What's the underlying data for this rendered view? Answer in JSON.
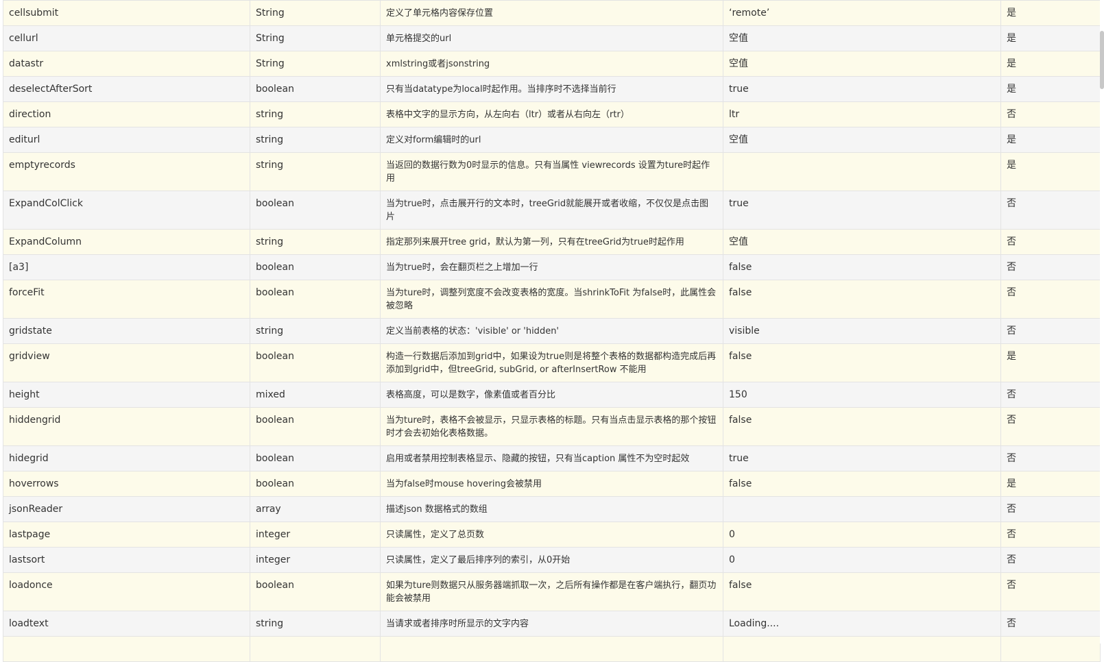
{
  "rows": [
    {
      "name": "cellsubmit",
      "type": "String",
      "desc": "定义了单元格内容保存位置",
      "default": "‘remote’",
      "editable": "是"
    },
    {
      "name": "cellurl",
      "type": "String",
      "desc": "单元格提交的url",
      "default": "空值",
      "editable": "是"
    },
    {
      "name": "datastr",
      "type": "String",
      "desc": "xmlstring或者jsonstring",
      "default": "空值",
      "editable": "是"
    },
    {
      "name": "deselectAfterSort",
      "type": "boolean",
      "desc": "只有当datatype为local时起作用。当排序时不选择当前行",
      "default": "true",
      "editable": "是"
    },
    {
      "name": "direction",
      "type": "string",
      "desc": "表格中文字的显示方向，从左向右（ltr）或者从右向左（rtr）",
      "default": "ltr",
      "editable": "否"
    },
    {
      "name": "editurl",
      "type": "string",
      "desc": "定义对form编辑时的url",
      "default": "空值",
      "editable": "是"
    },
    {
      "name": "emptyrecords",
      "type": "string",
      "desc": "当返回的数据行数为0时显示的信息。只有当属性 viewrecords 设置为ture时起作用",
      "default": "",
      "editable": "是"
    },
    {
      "name": "ExpandColClick",
      "type": "boolean",
      "desc": "当为true时，点击展开行的文本时，treeGrid就能展开或者收缩，不仅仅是点击图片",
      "default": "true",
      "editable": "否"
    },
    {
      "name": "ExpandColumn",
      "type": "string",
      "desc": "指定那列来展开tree grid，默认为第一列，只有在treeGrid为true时起作用",
      "default": "空值",
      "editable": "否"
    },
    {
      "name": "[a3]",
      "type": "boolean",
      "desc": "当为true时，会在翻页栏之上增加一行",
      "default": "false",
      "editable": "否"
    },
    {
      "name": "forceFit",
      "type": "boolean",
      "desc": "当为ture时，调整列宽度不会改变表格的宽度。当shrinkToFit 为false时，此属性会被忽略",
      "default": "false",
      "editable": "否"
    },
    {
      "name": "gridstate",
      "type": "string",
      "desc": "定义当前表格的状态：'visible' or 'hidden'",
      "default": "visible",
      "editable": "否"
    },
    {
      "name": "gridview",
      "type": "boolean",
      "desc": "构造一行数据后添加到grid中，如果设为true则是将整个表格的数据都构造完成后再添加到grid中，但treeGrid, subGrid, or afterInsertRow 不能用",
      "default": "false",
      "editable": "是"
    },
    {
      "name": "height",
      "type": "mixed",
      "desc": "表格高度，可以是数字，像素值或者百分比",
      "default": "150",
      "editable": "否"
    },
    {
      "name": "hiddengrid",
      "type": "boolean",
      "desc": "当为ture时，表格不会被显示，只显示表格的标题。只有当点击显示表格的那个按钮时才会去初始化表格数据。",
      "default": "false",
      "editable": "否"
    },
    {
      "name": "hidegrid",
      "type": "boolean",
      "desc": "启用或者禁用控制表格显示、隐藏的按钮，只有当caption 属性不为空时起效",
      "default": "true",
      "editable": "否"
    },
    {
      "name": "hoverrows",
      "type": "boolean",
      "desc": "当为false时mouse hovering会被禁用",
      "default": "false",
      "editable": "是"
    },
    {
      "name": "jsonReader",
      "type": "array",
      "desc": "描述json 数据格式的数组",
      "default": "",
      "editable": "否"
    },
    {
      "name": "lastpage",
      "type": "integer",
      "desc": "只读属性，定义了总页数",
      "default": "0",
      "editable": "否"
    },
    {
      "name": "lastsort",
      "type": "integer",
      "desc": "只读属性，定义了最后排序列的索引，从0开始",
      "default": "0",
      "editable": "否"
    },
    {
      "name": "loadonce",
      "type": "boolean",
      "desc": "如果为ture则数据只从服务器端抓取一次，之后所有操作都是在客户端执行，翻页功能会被禁用",
      "default": "false",
      "editable": "否"
    },
    {
      "name": "loadtext",
      "type": "string",
      "desc": "当请求或者排序时所显示的文字内容",
      "default": "Loading....",
      "editable": "否"
    },
    {
      "name": "",
      "type": "",
      "desc": "",
      "default": "",
      "editable": ""
    }
  ]
}
